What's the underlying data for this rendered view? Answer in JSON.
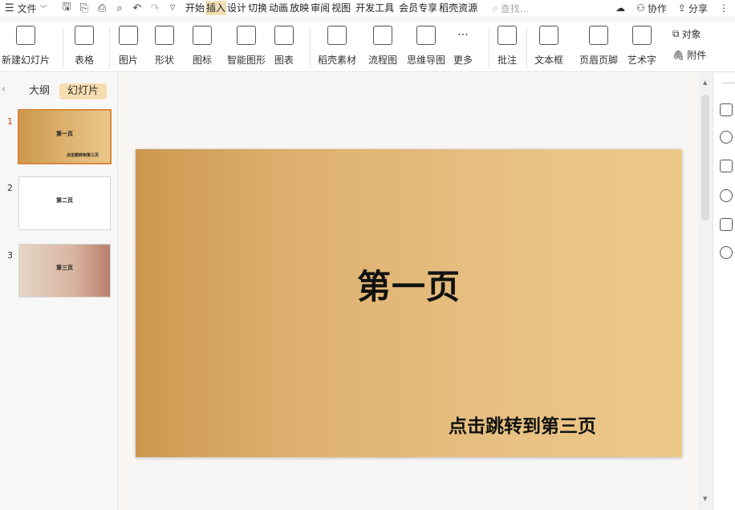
{
  "titlebar": {
    "file_label": "文件",
    "tabs": [
      "开始",
      "插入",
      "设计",
      "切换",
      "动画",
      "放映",
      "审阅",
      "视图",
      "开发工具",
      "会员专享",
      "稻壳资源"
    ],
    "active_tab": "插入",
    "search_placeholder": "查找...",
    "collab_label": "协作",
    "share_label": "分享"
  },
  "ribbon": {
    "new_slide": "新建幻灯片",
    "table": "表格",
    "picture": "图片",
    "shape": "形状",
    "icon": "图标",
    "smart_art": "智能图形",
    "chart": "图表",
    "daoke": "稻壳素材",
    "flowchart": "流程图",
    "mindmap": "思维导图",
    "more": "更多",
    "comment": "批注",
    "textbox": "文本框",
    "header_footer": "页眉页脚",
    "wordart": "艺术字",
    "object": "对象",
    "attachment": "附件"
  },
  "left_panel": {
    "outline_tab": "大纲",
    "slides_tab": "幻灯片",
    "thumbs": [
      {
        "num": "1",
        "title": "第一页",
        "sub": "点击跳转到第三页",
        "active": true
      },
      {
        "num": "2",
        "title": "第二页",
        "sub": "",
        "active": false
      },
      {
        "num": "3",
        "title": "第三页",
        "sub": "",
        "active": false
      }
    ]
  },
  "slide": {
    "title": "第一页",
    "link_text": "点击跳转到第三页"
  },
  "colors": {
    "accent": "#f3dfb5",
    "active_num": "#d83b01",
    "slide_grad_start": "#cc9850",
    "slide_grad_end": "#ecc889"
  }
}
